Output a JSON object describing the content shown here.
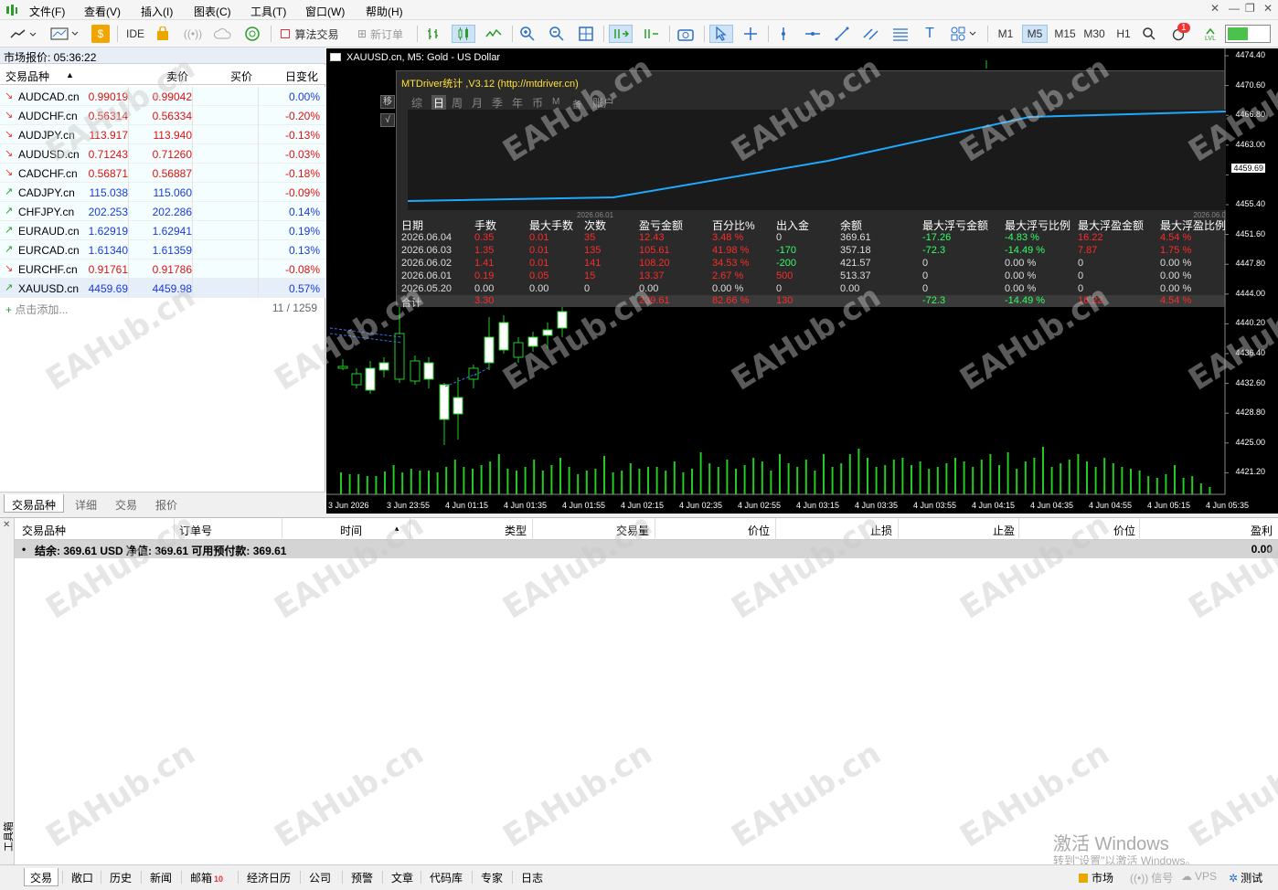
{
  "menu": {
    "items": [
      "文件(F)",
      "查看(V)",
      "插入(I)",
      "图表(C)",
      "工具(T)",
      "窗口(W)",
      "帮助(H)"
    ]
  },
  "toolbar": {
    "ide": "IDE",
    "algo": "算法交易",
    "neworder": "新订单",
    "timeframes": [
      "M1",
      "M5",
      "M15",
      "M30",
      "H1"
    ],
    "active_tf": "M5",
    "notif_count": "1",
    "lvl": "LVL"
  },
  "market": {
    "title": "市场报价: 05:36:22",
    "headers": {
      "symbol": "交易品种",
      "bid": "卖价",
      "ask": "买价",
      "change": "日变化"
    },
    "rows": [
      {
        "sym": "AUDCAD.cn",
        "bid": "0.99019",
        "ask": "0.99042",
        "chg": "0.00%",
        "dir": "down"
      },
      {
        "sym": "AUDCHF.cn",
        "bid": "0.56314",
        "ask": "0.56334",
        "chg": "-0.20%",
        "dir": "down"
      },
      {
        "sym": "AUDJPY.cn",
        "bid": "113.917",
        "ask": "113.940",
        "chg": "-0.13%",
        "dir": "down"
      },
      {
        "sym": "AUDUSD.cn",
        "bid": "0.71243",
        "ask": "0.71260",
        "chg": "-0.03%",
        "dir": "down"
      },
      {
        "sym": "CADCHF.cn",
        "bid": "0.56871",
        "ask": "0.56887",
        "chg": "-0.18%",
        "dir": "down"
      },
      {
        "sym": "CADJPY.cn",
        "bid": "115.038",
        "ask": "115.060",
        "chg": "-0.09%",
        "dir": "up"
      },
      {
        "sym": "CHFJPY.cn",
        "bid": "202.253",
        "ask": "202.286",
        "chg": "0.14%",
        "dir": "up"
      },
      {
        "sym": "EURAUD.cn",
        "bid": "1.62919",
        "ask": "1.62941",
        "chg": "0.19%",
        "dir": "up"
      },
      {
        "sym": "EURCAD.cn",
        "bid": "1.61340",
        "ask": "1.61359",
        "chg": "0.13%",
        "dir": "up"
      },
      {
        "sym": "EURCHF.cn",
        "bid": "0.91761",
        "ask": "0.91786",
        "chg": "-0.08%",
        "dir": "down"
      },
      {
        "sym": "XAUUSD.cn",
        "bid": "4459.69",
        "ask": "4459.98",
        "chg": "0.57%",
        "dir": "up"
      }
    ],
    "add_label": "点击添加...",
    "count": "11 / 1259",
    "tabs": [
      "交易品种",
      "详细",
      "交易",
      "报价"
    ]
  },
  "chart": {
    "title": "XAUUSD.cn, M5:  Gold - US Dollar",
    "current_price": "4459.69",
    "price_labels": [
      "4474.40",
      "4470.60",
      "4466.80",
      "4463.00",
      "4455.40",
      "4451.60",
      "4447.80",
      "4444.00",
      "4440.20",
      "4436.40",
      "4432.60",
      "4428.80",
      "4425.00",
      "4421.20"
    ],
    "time_labels": [
      "3 Jun 2026",
      "3 Jun 23:55",
      "4 Jun 01:15",
      "4 Jun 01:35",
      "4 Jun 01:55",
      "4 Jun 02:15",
      "4 Jun 02:35",
      "4 Jun 02:55",
      "4 Jun 03:15",
      "4 Jun 03:35",
      "4 Jun 03:55",
      "4 Jun 04:15",
      "4 Jun 04:35",
      "4 Jun 04:55",
      "4 Jun 05:15",
      "4 Jun 05:35"
    ],
    "side_buttons": [
      "移",
      "√"
    ]
  },
  "stats": {
    "title": "MTDriver统计 ,V3.12 (http://mtdriver.cn)",
    "tabs": [
      "综",
      "日",
      "周",
      "月",
      "季",
      "年",
      "币",
      "M",
      "备",
      "账户"
    ],
    "active_tab": "日",
    "eq_dates": [
      "2026.06.01",
      "2026.06.0"
    ],
    "headers": [
      "日期",
      "手数",
      "最大手数",
      "次数",
      "盈亏金额",
      "百分比%",
      "出入金",
      "余额",
      "最大浮亏金额",
      "最大浮亏比例",
      "最大浮盈金额",
      "最大浮盈比例"
    ],
    "rows": [
      [
        "2026.06.04",
        "0.35",
        "0.01",
        "35",
        "12.43",
        "3.48 %",
        "0",
        "369.61",
        "-17.26",
        "-4.83 %",
        "16.22",
        "4.54 %"
      ],
      [
        "2026.06.03",
        "1.35",
        "0.01",
        "135",
        "105.61",
        "41.98 %",
        "-170",
        "357.18",
        "-72.3",
        "-14.49 %",
        "7.87",
        "1.75 %"
      ],
      [
        "2026.06.02",
        "1.41",
        "0.01",
        "141",
        "108.20",
        "34.53 %",
        "-200",
        "421.57",
        "0",
        "0.00 %",
        "0",
        "0.00 %"
      ],
      [
        "2026.06.01",
        "0.19",
        "0.05",
        "15",
        "13.37",
        "2.67 %",
        "500",
        "513.37",
        "0",
        "0.00 %",
        "0",
        "0.00 %"
      ],
      [
        "2026.05.20",
        "0.00",
        "0.00",
        "0",
        "0.00",
        "0.00 %",
        "0",
        "0.00",
        "0",
        "0.00 %",
        "0",
        "0.00 %"
      ]
    ],
    "total": [
      "合计",
      "3.30",
      "",
      "",
      "239.61",
      "82.66 %",
      "130",
      "",
      "-72.3",
      "-14.49 %",
      "16.22",
      "4.54 %"
    ],
    "colors": {
      "red": "#ff2a2a",
      "green": "#33ff66",
      "white": "#dddddd"
    }
  },
  "terminal": {
    "headers": [
      "交易品种",
      "订单号",
      "时间",
      "类型",
      "交易量",
      "价位",
      "止损",
      "止盈",
      "价位",
      "盈利"
    ],
    "balance": "结余: 369.61 USD  净值: 369.61  可用预付款: 369.61",
    "profit": "0.00",
    "side_label": "工具箱",
    "tabs": [
      "交易",
      "敞口",
      "历史",
      "新闻",
      "邮箱",
      "经济日历",
      "公司",
      "预警",
      "文章",
      "代码库",
      "专家",
      "日志"
    ],
    "mail_count": "10",
    "status": {
      "market": "市场",
      "signal": "信号",
      "vps": "VPS",
      "test": "测试"
    }
  },
  "activation": {
    "line1": "激活 Windows",
    "line2": "转到\"设置\"以激活 Windows。"
  },
  "watermark": "EAHub.cn"
}
